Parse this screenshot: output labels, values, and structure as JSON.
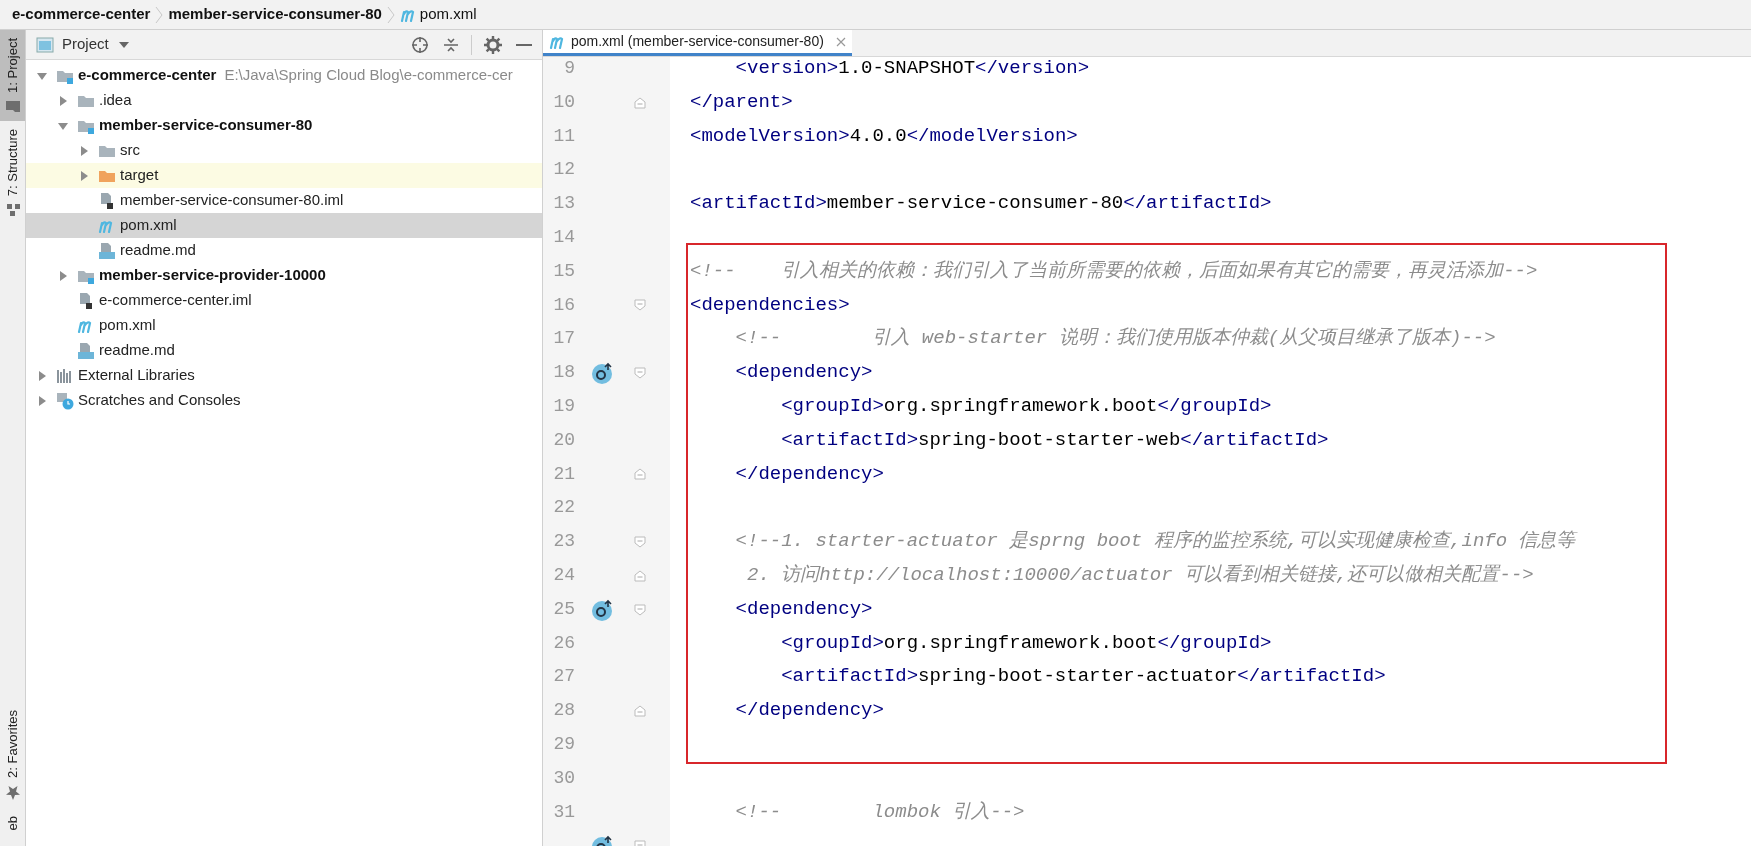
{
  "breadcrumbs": [
    {
      "label": "e-commerce-center",
      "kind": "module"
    },
    {
      "label": "member-service-consumer-80",
      "kind": "module"
    },
    {
      "label": "pom.xml",
      "kind": "maven"
    }
  ],
  "tool_strip": {
    "top": [
      {
        "label": "1: Project",
        "kind": "folder",
        "selected": true
      },
      {
        "label": "7: Structure",
        "kind": "structure",
        "selected": false
      }
    ],
    "bottom": [
      {
        "label": "2: Favorites",
        "kind": "star",
        "selected": false
      },
      {
        "label": "eb",
        "kind": "none",
        "selected": false
      }
    ]
  },
  "project_panel": {
    "title": "Project",
    "tree": [
      {
        "label": "e-commerce-center",
        "hint": "E:\\Java\\Spring Cloud Blog\\e-commerce-cer",
        "kind": "module",
        "expanded": true,
        "selected": false,
        "highlighted": false,
        "children": [
          {
            "label": ".idea",
            "kind": "folder",
            "expanded": false,
            "selected": false,
            "highlighted": false
          },
          {
            "label": "member-service-consumer-80",
            "kind": "module",
            "expanded": true,
            "selected": false,
            "highlighted": false,
            "children": [
              {
                "label": "src",
                "kind": "folder",
                "expanded": false,
                "selected": false,
                "highlighted": false
              },
              {
                "label": "target",
                "kind": "excluded-folder",
                "expanded": false,
                "selected": false,
                "highlighted": true
              },
              {
                "label": "member-service-consumer-80.iml",
                "kind": "iml",
                "selected": false,
                "highlighted": false
              },
              {
                "label": "pom.xml",
                "kind": "maven",
                "selected": true,
                "highlighted": false
              },
              {
                "label": "readme.md",
                "kind": "markdown",
                "selected": false,
                "highlighted": false
              }
            ]
          },
          {
            "label": "member-service-provider-10000",
            "kind": "module",
            "expanded": false,
            "selected": false,
            "highlighted": false
          },
          {
            "label": "e-commerce-center.iml",
            "kind": "iml",
            "selected": false,
            "highlighted": false
          },
          {
            "label": "pom.xml",
            "kind": "maven",
            "selected": false,
            "highlighted": false
          },
          {
            "label": "readme.md",
            "kind": "markdown",
            "selected": false,
            "highlighted": false
          }
        ]
      },
      {
        "label": "External Libraries",
        "kind": "libraries",
        "expanded": false,
        "selected": false,
        "highlighted": false
      },
      {
        "label": "Scratches and Consoles",
        "kind": "scratches",
        "expanded": false,
        "selected": false,
        "highlighted": false
      }
    ]
  },
  "editor": {
    "tabs": [
      {
        "label": "pom.xml (member-service-consumer-80)",
        "selected": true
      }
    ],
    "sections": [
      {
        "boxed": false,
        "lines": [
          {
            "number": "9",
            "marker": false,
            "segments": [
              {
                "kind": "tag",
                "text": "    <version>"
              },
              {
                "kind": "text",
                "text": "1.0-SNAPSHOT"
              },
              {
                "kind": "tag",
                "text": "</version>"
              }
            ]
          },
          {
            "number": "10",
            "marker": false,
            "fold": {
              "kind": "end"
            },
            "segments": [
              {
                "kind": "tag",
                "text": "</parent>"
              }
            ]
          },
          {
            "number": "11",
            "marker": false,
            "segments": [
              {
                "kind": "tag",
                "text": "<modelVersion>"
              },
              {
                "kind": "text",
                "text": "4.0.0"
              },
              {
                "kind": "tag",
                "text": "</modelVersion>"
              }
            ]
          },
          {
            "number": "12",
            "marker": false
          },
          {
            "number": "13",
            "marker": false,
            "segments": [
              {
                "kind": "tag",
                "text": "<artifactId>"
              },
              {
                "kind": "text",
                "text": "member-service-consumer-80"
              },
              {
                "kind": "tag",
                "text": "</artifactId>"
              }
            ]
          },
          {
            "number": "14",
            "marker": false
          }
        ]
      },
      {
        "boxed": true,
        "lines": [
          {
            "number": "15",
            "marker": false,
            "segments": [
              {
                "kind": "comment",
                "text": "<!--    引入相关的依赖：我们引入了当前所需要的依赖，后面如果有其它的需要，再灵活添加-->"
              }
            ]
          },
          {
            "number": "16",
            "marker": false,
            "fold": {
              "kind": "start"
            },
            "segments": [
              {
                "kind": "tag",
                "text": "<dependencies>"
              }
            ]
          },
          {
            "number": "17",
            "marker": false,
            "segments": [
              {
                "kind": "comment",
                "text": "    <!--        引入 web-starter 说明：我们使用版本仲裁(从父项目继承了版本)-->"
              }
            ]
          },
          {
            "number": "18",
            "marker": true,
            "fold": {
              "kind": "start"
            },
            "segments": [
              {
                "kind": "tag",
                "text": "    <dependency>"
              }
            ]
          },
          {
            "number": "19",
            "marker": false,
            "segments": [
              {
                "kind": "tag",
                "text": "        <groupId>"
              },
              {
                "kind": "text",
                "text": "org.springframework.boot"
              },
              {
                "kind": "tag",
                "text": "</groupId>"
              }
            ]
          },
          {
            "number": "20",
            "marker": false,
            "segments": [
              {
                "kind": "tag",
                "text": "        <artifactId>"
              },
              {
                "kind": "text",
                "text": "spring-boot-starter-web"
              },
              {
                "kind": "tag",
                "text": "</artifactId>"
              }
            ]
          },
          {
            "number": "21",
            "marker": false,
            "fold": {
              "kind": "end"
            },
            "segments": [
              {
                "kind": "tag",
                "text": "    </dependency>"
              }
            ]
          },
          {
            "number": "22",
            "marker": false
          },
          {
            "number": "23",
            "marker": false,
            "fold": {
              "kind": "start"
            },
            "segments": [
              {
                "kind": "comment",
                "text": "    <!--1. starter-actuator 是sprng boot 程序的监控系统,可以实现健康检查,info 信息等"
              }
            ]
          },
          {
            "number": "24",
            "marker": false,
            "fold": {
              "kind": "end"
            },
            "segments": [
              {
                "kind": "comment",
                "text": "     2. 访问http://localhost:10000/actuator 可以看到相关链接,还可以做相关配置-->"
              }
            ]
          },
          {
            "number": "25",
            "marker": true,
            "fold": {
              "kind": "start"
            },
            "segments": [
              {
                "kind": "tag",
                "text": "    <dependency>"
              }
            ]
          },
          {
            "number": "26",
            "marker": false,
            "segments": [
              {
                "kind": "tag",
                "text": "        <groupId>"
              },
              {
                "kind": "text",
                "text": "org.springframework.boot"
              },
              {
                "kind": "tag",
                "text": "</groupId>"
              }
            ]
          },
          {
            "number": "27",
            "marker": false,
            "segments": [
              {
                "kind": "tag",
                "text": "        <artifactId>"
              },
              {
                "kind": "text",
                "text": "spring-boot-starter-actuator"
              },
              {
                "kind": "tag",
                "text": "</artifactId>"
              }
            ]
          },
          {
            "number": "28",
            "marker": false,
            "fold": {
              "kind": "end"
            },
            "segments": [
              {
                "kind": "tag",
                "text": "    </dependency>"
              }
            ]
          },
          {
            "number": "29",
            "marker": false
          }
        ]
      },
      {
        "boxed": false,
        "lines": [
          {
            "number": "30",
            "marker": false
          },
          {
            "number": "31",
            "marker": false,
            "segments": [
              {
                "kind": "comment",
                "text": "    <!--        lombok 引入-->"
              }
            ]
          },
          {
            "marker": true,
            "fold": {
              "kind": "start"
            }
          }
        ]
      }
    ]
  }
}
